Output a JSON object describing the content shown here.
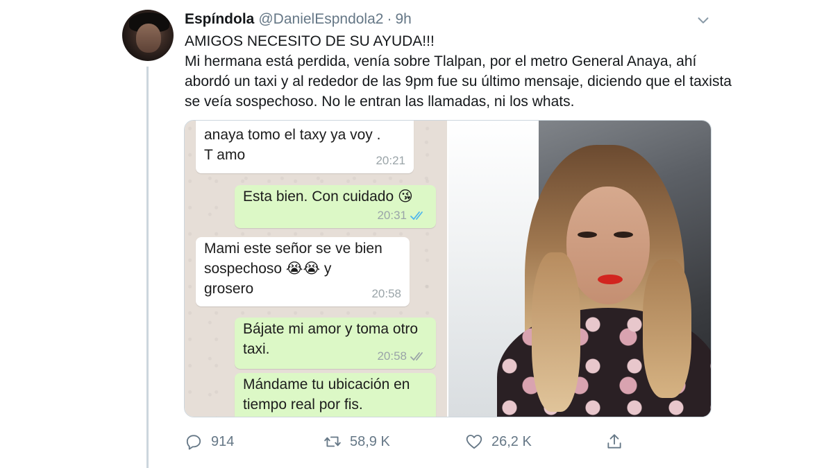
{
  "tweet": {
    "author_name": "Espíndola",
    "author_handle": "@DanielEspndola2",
    "separator": "·",
    "time": "9h",
    "text_lines": [
      "AMIGOS NECESITO DE SU AYUDA!!!",
      "Mi hermana está perdida, venía sobre Tlalpan, por el metro General Anaya, ahí abordó un taxi y al rededor de las 9pm fue su último mensaje, diciendo que el taxista se veía sospechoso. No le entran las llamadas, ni los whats."
    ]
  },
  "chat": {
    "messages": [
      {
        "text": "anaya tomo el taxy  ya voy .\nT  amo",
        "time": "20:21"
      },
      {
        "text": "Esta bien. Con cuidado 😘",
        "time": "20:31"
      },
      {
        "text": "Mami este señor se ve bien\nsospechoso 😭😭 y\ngrosero",
        "time": "20:58"
      },
      {
        "text": "Bájate mi amor y toma otro\ntaxi.",
        "time": "20:58"
      },
      {
        "text": "Mándame tu ubicación en\ntiempo real por fis.",
        "time": ""
      }
    ]
  },
  "actions": {
    "replies": "914",
    "retweets": "58,9 K",
    "likes": "26,2 K"
  },
  "icons": {
    "chevron": "chevron-down-icon",
    "reply": "reply-icon",
    "retweet": "retweet-icon",
    "like": "heart-icon",
    "share": "share-icon",
    "read_receipt": "double-check-icon"
  },
  "colors": {
    "text": "#14171a",
    "muted": "#657786",
    "border": "#ccd6dd",
    "chat_out": "#dcf8c6",
    "chat_bg": "#e6ded7",
    "read_blue": "#4fb6ec"
  }
}
